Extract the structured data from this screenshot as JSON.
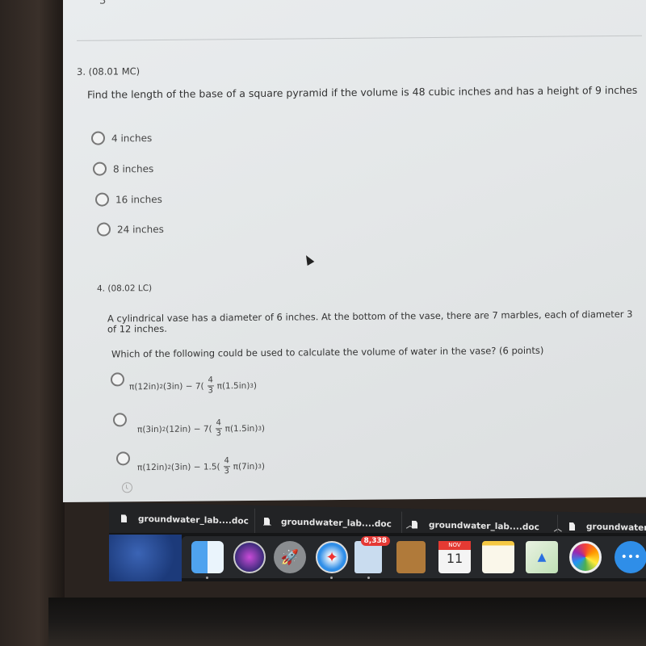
{
  "quiz": {
    "prev_fragment": "3",
    "q3": {
      "header": "3. (08.01 MC)",
      "text": "Find the length of the base of a square pyramid if the volume is 48 cubic inches and has a height of 9 inches",
      "options": [
        "4 inches",
        "8 inches",
        "16 inches",
        "24 inches"
      ]
    },
    "q4": {
      "header": "4. (08.02 LC)",
      "text_line1": "A cylindrical vase has a diameter of 6 inches. At the bottom of the vase, there are 7 marbles, each of diameter 3",
      "text_line2": "of 12 inches.",
      "prompt": "Which of the following could be used to calculate the volume of water in the vase? (6 points)",
      "options": [
        {
          "pre": "π(12in)",
          "exp": "2",
          "mid": "(3in) − 7(",
          "num": "4",
          "den": "3",
          "post": "π(1.5in)",
          "exp2": "3",
          "end": ")"
        },
        {
          "pre": "π(3in)",
          "exp": "2",
          "mid": "(12in) − 7(",
          "num": "4",
          "den": "3",
          "post": "π(1.5in)",
          "exp2": "3",
          "end": ")"
        },
        {
          "pre": "π(12in)",
          "exp": "2",
          "mid": "(3in) − 1.5(",
          "num": "4",
          "den": "3",
          "post": "π(7in)",
          "exp2": "3",
          "end": ")"
        }
      ]
    }
  },
  "downloads": [
    {
      "name": "groundwater_lab....doc",
      "icon": "document-icon"
    },
    {
      "name": "groundwater_lab....doc",
      "icon": "document-icon"
    },
    {
      "name": "groundwater_lab....doc",
      "icon": "document-icon"
    },
    {
      "name": "groundwater_",
      "icon": "document-icon"
    }
  ],
  "dock": {
    "apps": [
      "Finder",
      "Siri",
      "Launchpad",
      "Safari",
      "Mail",
      "Contacts",
      "Calendar",
      "Notes",
      "Maps",
      "Photos",
      "Messages"
    ],
    "mail_badge": "8,338",
    "calendar_month": "NOV",
    "calendar_day": "11"
  },
  "colors": {
    "badge": "#e53935",
    "calendar_red": "#e43a33"
  }
}
